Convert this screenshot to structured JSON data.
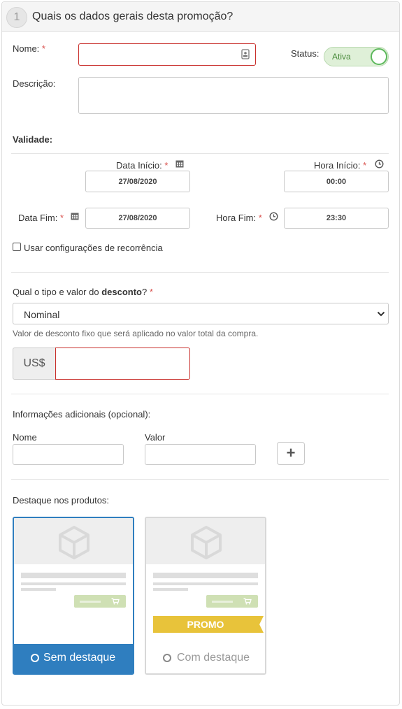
{
  "header": {
    "step": "1",
    "title": "Quais os dados gerais desta promoção?"
  },
  "form": {
    "name_label": "Nome:",
    "required_mark": "*",
    "status_label": "Status:",
    "status_value": "Ativa",
    "description_label": "Descrição:",
    "validity_title": "Validade:",
    "start_date_label": "Data Início:",
    "start_date_value": "27/08/2020",
    "start_time_label": "Hora Início:",
    "start_time_value": "00:00",
    "end_date_label": "Data Fim:",
    "end_date_value": "27/08/2020",
    "end_time_label": "Hora Fim:",
    "end_time_value": "23:30",
    "recurrence_label": "Usar configurações de recorrência",
    "discount_question_prefix": "Qual o tipo e valor do ",
    "discount_question_bold": "desconto",
    "discount_question_suffix": "?",
    "discount_type_value": "Nominal",
    "discount_help": "Valor de desconto fixo que será aplicado no valor total da compra.",
    "currency_addon": "US$",
    "additional_info_label": "Informações adicionais (opcional):",
    "additional_name_label": "Nome",
    "additional_value_label": "Valor",
    "add_button": "+",
    "highlight_label": "Destaque nos produtos:",
    "option_none": "Sem destaque",
    "option_promo": "Com destaque",
    "promo_badge": "PROMO"
  },
  "colors": {
    "accent": "#2f7ebf",
    "error": "#c9302c",
    "success": "#5cb85c",
    "promo": "#e8c33a"
  },
  "icons": {
    "name_field": "contact-card-icon",
    "date": "calendar-icon",
    "time": "clock-icon",
    "product": "cube-icon",
    "cart": "cart-icon",
    "select": "chevron-down-icon"
  }
}
